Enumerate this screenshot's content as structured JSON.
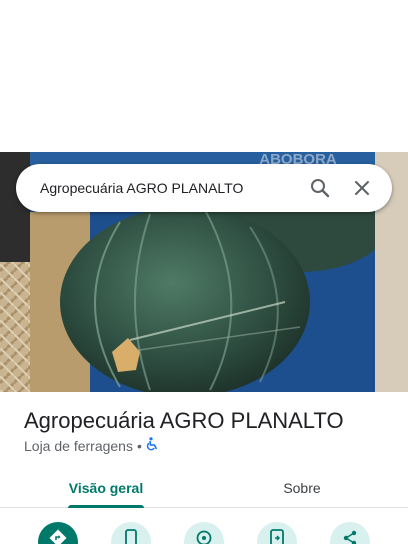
{
  "search": {
    "query": "Agropecuária AGRO PLANALTO"
  },
  "hero": {
    "package_text": "ABOBORA"
  },
  "place": {
    "name": "Agropecuária AGRO PLANALTO",
    "category": "Loja de ferragens",
    "separator": "•"
  },
  "tabs": [
    {
      "label": "Visão geral",
      "selected": true
    },
    {
      "label": "Sobre",
      "selected": false
    }
  ],
  "actions": [
    {
      "icon": "directions-icon"
    },
    {
      "icon": "phone-icon"
    },
    {
      "icon": "save-icon"
    },
    {
      "icon": "send-to-phone-icon"
    },
    {
      "icon": "share-icon"
    }
  ],
  "colors": {
    "accent": "#00796b",
    "accent_light": "#d8f0ee",
    "accessibility_blue": "#1a73e8"
  }
}
